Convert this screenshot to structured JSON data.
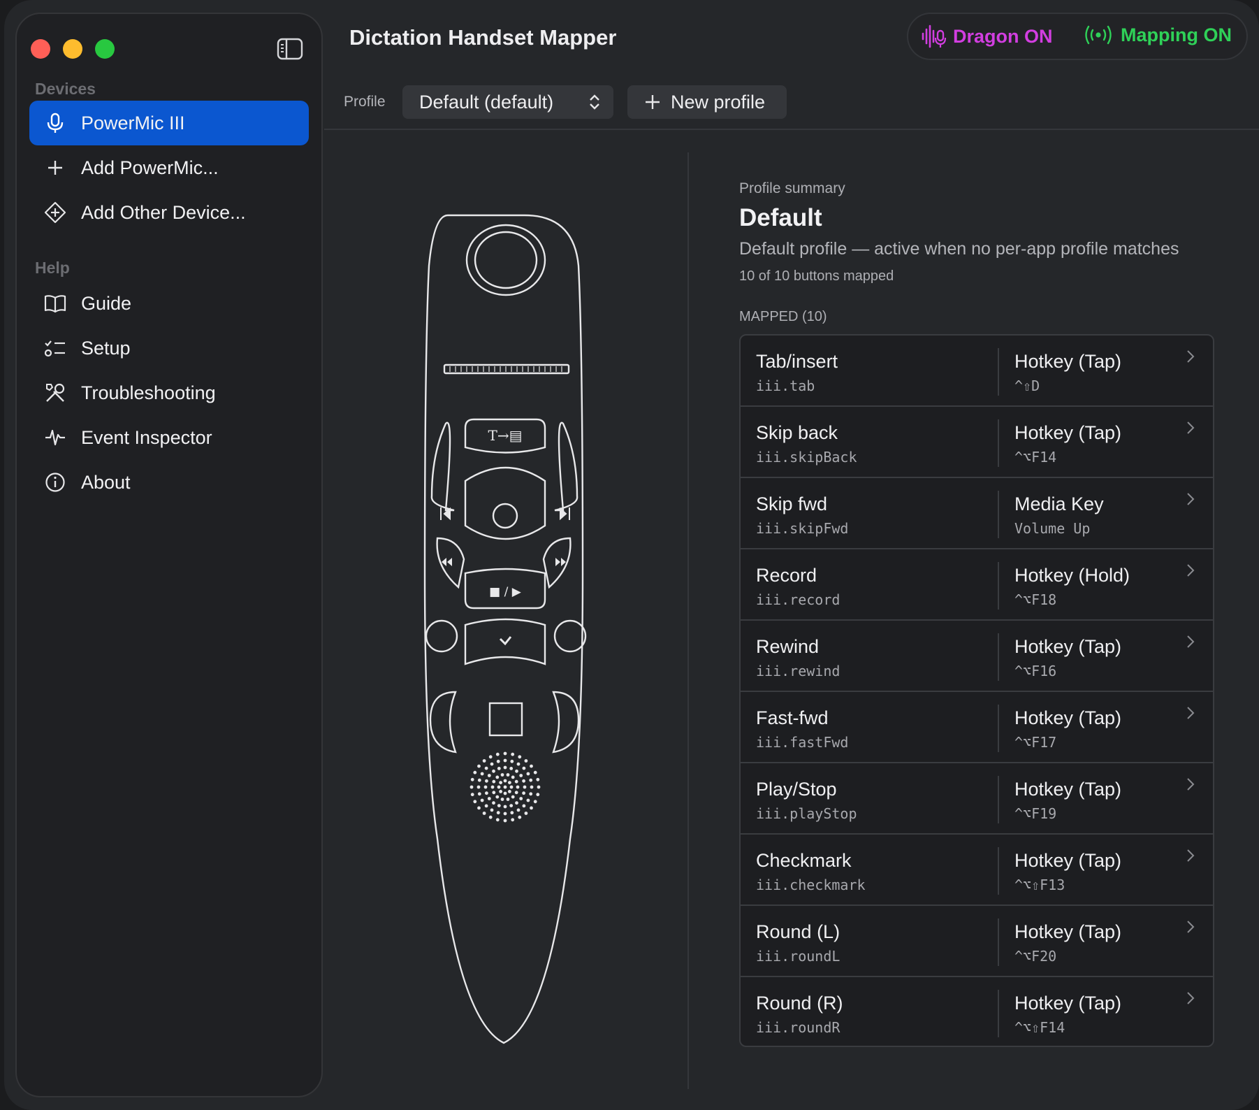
{
  "window": {
    "title": "Dictation Handset Mapper"
  },
  "sidebar": {
    "devices_header": "Devices",
    "devices": [
      {
        "label": "PowerMic III",
        "icon": "microphone-icon",
        "active": true
      },
      {
        "label": "Add PowerMic...",
        "icon": "plus-icon"
      },
      {
        "label": "Add Other Device...",
        "icon": "diamond-plus-icon"
      }
    ],
    "help_header": "Help",
    "help": [
      {
        "label": "Guide",
        "icon": "book-icon"
      },
      {
        "label": "Setup",
        "icon": "checklist-icon"
      },
      {
        "label": "Troubleshooting",
        "icon": "tools-icon"
      },
      {
        "label": "Event Inspector",
        "icon": "waveform-icon"
      },
      {
        "label": "About",
        "icon": "info-icon"
      }
    ]
  },
  "status": {
    "dragon": {
      "label": "Dragon ON",
      "color": "#d23ee0",
      "icon": "waveform-mic-icon"
    },
    "mapping": {
      "label": "Mapping ON",
      "color": "#2fd158",
      "icon": "broadcast-icon"
    }
  },
  "toolbar": {
    "profile_label": "Profile",
    "profile_value": "Default (default)",
    "new_profile_label": "New profile"
  },
  "device": {
    "button_glyph_transcribe": "T→▤",
    "button_glyph_playstop": "■ / ▶"
  },
  "summary": {
    "label": "Profile summary",
    "name": "Default",
    "description": "Default profile — active when no per-app profile matches",
    "count": "10 of 10 buttons mapped",
    "mapped_header": "MAPPED (10)"
  },
  "mappings": [
    {
      "name": "Tab/insert",
      "id": "iii.tab",
      "action": "Hotkey (Tap)",
      "key": "^⇧D"
    },
    {
      "name": "Skip back",
      "id": "iii.skipBack",
      "action": "Hotkey (Tap)",
      "key": "^⌥F14"
    },
    {
      "name": "Skip fwd",
      "id": "iii.skipFwd",
      "action": "Media Key",
      "key": "Volume Up"
    },
    {
      "name": "Record",
      "id": "iii.record",
      "action": "Hotkey (Hold)",
      "key": "^⌥F18"
    },
    {
      "name": "Rewind",
      "id": "iii.rewind",
      "action": "Hotkey (Tap)",
      "key": "^⌥F16"
    },
    {
      "name": "Fast-fwd",
      "id": "iii.fastFwd",
      "action": "Hotkey (Tap)",
      "key": "^⌥F17"
    },
    {
      "name": "Play/Stop",
      "id": "iii.playStop",
      "action": "Hotkey (Tap)",
      "key": "^⌥F19"
    },
    {
      "name": "Checkmark",
      "id": "iii.checkmark",
      "action": "Hotkey (Tap)",
      "key": "^⌥⇧F13"
    },
    {
      "name": "Round (L)",
      "id": "iii.roundL",
      "action": "Hotkey (Tap)",
      "key": "^⌥F20"
    },
    {
      "name": "Round (R)",
      "id": "iii.roundR",
      "action": "Hotkey (Tap)",
      "key": "^⌥⇧F14"
    }
  ]
}
